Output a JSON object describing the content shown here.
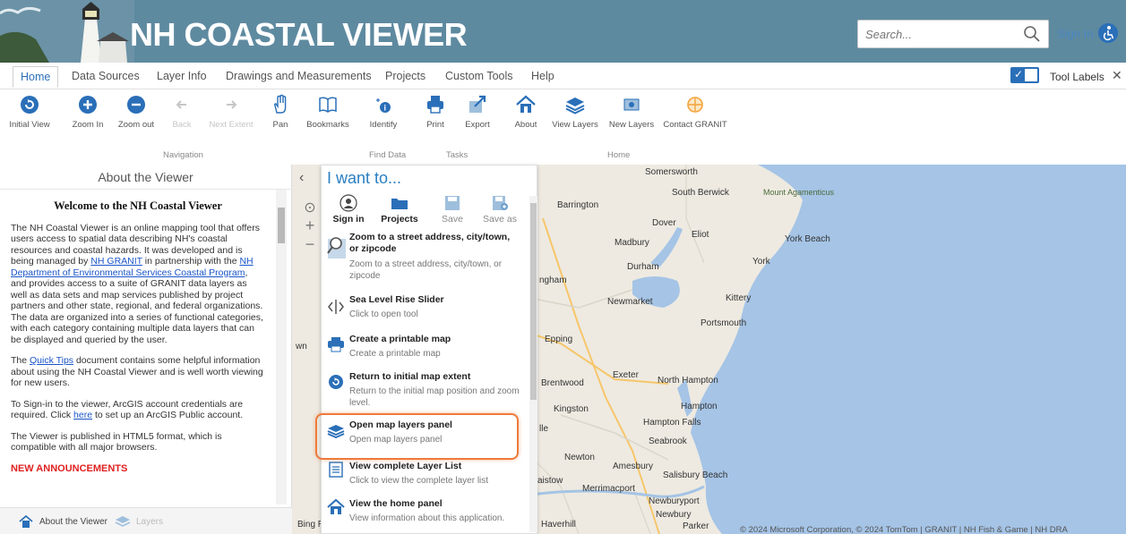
{
  "header": {
    "title": "NH COASTAL VIEWER",
    "search_placeholder": "Search...",
    "signin": "Sign In"
  },
  "ribbon": {
    "tabs": [
      "Home",
      "Data Sources",
      "Layer Info",
      "Drawings and Measurements",
      "Projects",
      "Custom Tools",
      "Help"
    ],
    "tool_labels": "Tool Labels"
  },
  "toolbar": {
    "tools": [
      {
        "label": "Initial View",
        "icon": "initial-view-icon",
        "enabled": true
      },
      {
        "label": "Zoom In",
        "icon": "zoom-in-icon",
        "enabled": true
      },
      {
        "label": "Zoom out",
        "icon": "zoom-out-icon",
        "enabled": true
      },
      {
        "label": "Back",
        "icon": "back-icon",
        "enabled": false
      },
      {
        "label": "Next Extent",
        "icon": "forward-icon",
        "enabled": false
      },
      {
        "label": "Pan",
        "icon": "pan-hand-icon",
        "enabled": true
      },
      {
        "label": "Bookmarks",
        "icon": "bookmark-icon",
        "enabled": true
      },
      {
        "label": "Identify",
        "icon": "identify-icon",
        "enabled": true
      },
      {
        "label": "Print",
        "icon": "print-icon",
        "enabled": true
      },
      {
        "label": "Export",
        "icon": "export-icon",
        "enabled": true
      },
      {
        "label": "About",
        "icon": "home-icon",
        "enabled": true
      },
      {
        "label": "View Layers",
        "icon": "layers-icon",
        "enabled": true
      },
      {
        "label": "New Layers",
        "icon": "new-layers-icon",
        "enabled": true
      },
      {
        "label": "Contact GRANIT",
        "icon": "contact-icon",
        "enabled": true
      }
    ],
    "groups": [
      "Navigation",
      "Find Data",
      "Tasks",
      "Home"
    ]
  },
  "left_panel": {
    "title": "About the Viewer",
    "heading": "Welcome to the NH Coastal Viewer",
    "p1_a": "The NH Coastal Viewer is an online mapping tool that offers users access to spatial data describing NH's coastal resources and coastal hazards. It was developed and is being managed by ",
    "p1_link1": "NH GRANIT",
    "p1_b": " in partnership with the ",
    "p1_link2": "NH Department of Environmental Services Coastal Program",
    "p1_c": ", and provides access to a suite of GRANIT data layers as well as data sets and map services published by project partners and other state, regional, and federal organizations. The data are organized into a series of functional categories, with each category containing multiple data layers that can be displayed and queried by the user.",
    "p2_a": "The ",
    "p2_link": "Quick Tips",
    "p2_b": " document contains some helpful information about using the NH Coastal Viewer and is well worth viewing for new users.",
    "p3_a": "To Sign-in to the viewer, ArcGIS account credentials are required.  Click ",
    "p3_link": "here",
    "p3_b": " to set up an ArcGIS Public account.",
    "p4": "The Viewer is published in HTML5 format, which is compatible with all major browsers.",
    "announce": "NEW ANNOUNCEMENTS",
    "footer_about": "About the Viewer",
    "footer_layers": "Layers"
  },
  "iwant": {
    "title": "I want to...",
    "top_buttons": [
      {
        "label": "Sign in",
        "style": "bold"
      },
      {
        "label": "Projects",
        "style": "bold"
      },
      {
        "label": "Save",
        "style": "muted"
      },
      {
        "label": "Save as",
        "style": "muted"
      }
    ],
    "items": [
      {
        "title": "Zoom to a street address, city/town, or zipcode",
        "desc": "Zoom to a street address, city/town, or zipcode",
        "icon": "zoom-address-icon"
      },
      {
        "title": "Sea Level Rise Slider",
        "desc": "Click to open tool",
        "icon": "slider-icon"
      },
      {
        "title": "Create a printable map",
        "desc": "Create a printable map",
        "icon": "print-icon"
      },
      {
        "title": "Return to initial map extent",
        "desc": "Return to the initial map position and zoom level.",
        "icon": "initial-view-icon"
      },
      {
        "title": "Open map layers panel",
        "desc": "Open map layers panel",
        "icon": "layers-icon"
      },
      {
        "title": "View complete Layer List",
        "desc": "Click to view the complete layer list",
        "icon": "list-icon"
      },
      {
        "title": "View the home panel",
        "desc": "View information about this application.",
        "icon": "home-icon"
      }
    ]
  },
  "map": {
    "labels": [
      "Somersworth",
      "South Berwick",
      "Mount Agamenticus",
      "Barrington",
      "Dover",
      "Eliot",
      "York Beach",
      "Madbury",
      "York",
      "Durham",
      "Kittery",
      "Newmarket",
      "Portsmouth",
      "Epping",
      "Exeter",
      "North Hampton",
      "Brentwood",
      "Hampton",
      "Kingston",
      "Hampton Falls",
      "Seabrook",
      "Newton",
      "Amesbury",
      "Salisbury Beach",
      "Merrimacport",
      "Newburyport",
      "Newbury",
      "Haverhill",
      "Parker",
      "ngham",
      "wn",
      "aistow",
      "lle",
      "Bing R"
    ],
    "copyright": "© 2024 Microsoft Corporation, © 2024 TomTom | GRANIT | NH Fish & Game | NH DRA"
  },
  "colors": {
    "header_bg": "#5e8aa0",
    "accent": "#2a7fc1",
    "highlight": "#ee7a3a",
    "ocean": "#a5c4e6",
    "land": "#eeeae1"
  }
}
